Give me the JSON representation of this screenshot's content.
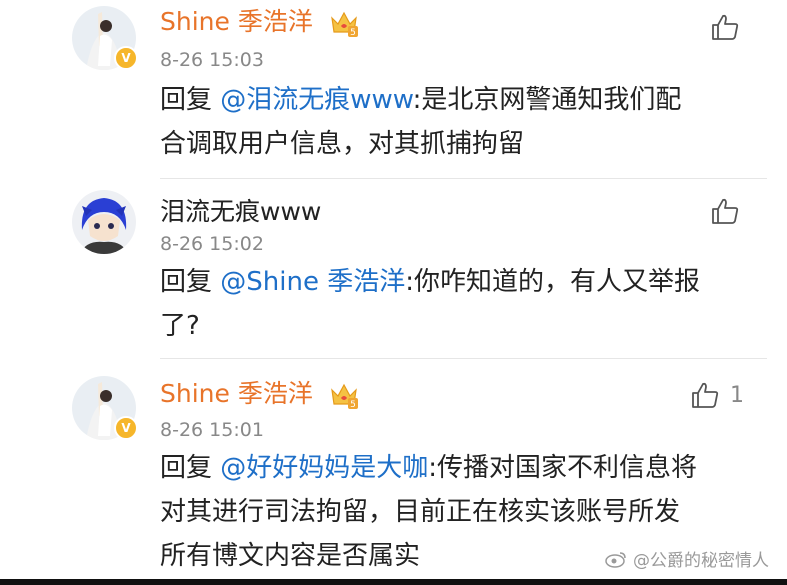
{
  "comments": [
    {
      "username": "Shine 季浩洋",
      "time": "8-26 15:03",
      "reply_prefix": "回复 ",
      "mention": "@泪流无痕www",
      "text_line1": ":是北京网警通知我们配",
      "text_line2": "合调取用户信息，对其抓捕拘留",
      "likes": ""
    },
    {
      "username": "泪流无痕www",
      "time": "8-26 15:02",
      "reply_prefix": "回复 ",
      "mention": "@Shine 季浩洋",
      "text_line1": ":你咋知道的，有人又举报",
      "text_line2": "了?",
      "likes": ""
    },
    {
      "username": "Shine 季浩洋",
      "time": "8-26 15:01",
      "reply_prefix": "回复 ",
      "mention": "@好好妈妈是大咖",
      "text_line1": ":传播对国家不利信息将",
      "text_line2": "对其进行司法拘留，目前正在核实该账号所发",
      "text_line3": "所有博文内容是否属实",
      "likes": "1"
    }
  ],
  "badge": {
    "verified_mark": "V",
    "vip_level": "5"
  },
  "watermark": "@公爵的秘密情人",
  "colors": {
    "vip_name": "#e8742a",
    "mention": "#1e6fc8",
    "time": "#888888",
    "badge": "#f6b62a"
  }
}
